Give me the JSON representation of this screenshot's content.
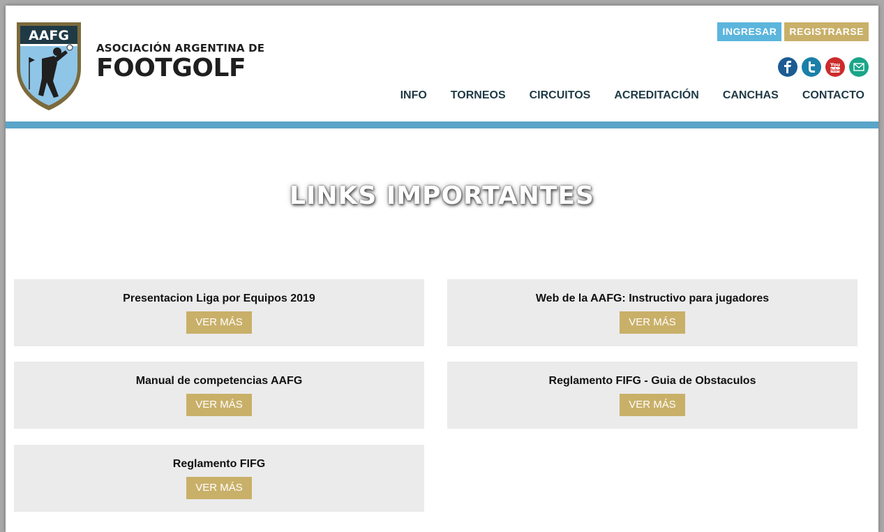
{
  "header": {
    "logo_abbr": "AAFG",
    "brand_line1": "ASOCIACIÓN ARGENTINA DE",
    "brand_line2": "FOOTGOLF",
    "login_label": "INGRESAR",
    "register_label": "REGISTRARSE",
    "social": [
      {
        "name": "facebook-icon",
        "glyph": "f",
        "color": "#1c5b93"
      },
      {
        "name": "twitter-icon",
        "glyph": "t",
        "color": "#1b7fa8"
      },
      {
        "name": "youtube-icon",
        "glyph": "You Tube",
        "color": "#cc2b2b"
      },
      {
        "name": "mail-icon",
        "glyph": "✉",
        "color": "#1aa589"
      }
    ],
    "nav": [
      "INFO",
      "TORNEOS",
      "CIRCUITOS",
      "ACREDITACIÓN",
      "CANCHAS",
      "CONTACTO"
    ]
  },
  "main": {
    "title": "LINKS IMPORTANTES",
    "links": [
      {
        "title": "Presentacion Liga por Equipos 2019",
        "button": "VER MÁS"
      },
      {
        "title": "Web de la AAFG: Instructivo para jugadores",
        "button": "VER MÁS"
      },
      {
        "title": "Manual de competencias AAFG",
        "button": "VER MÁS"
      },
      {
        "title": "Reglamento FIFG - Guia de Obstaculos",
        "button": "VER MÁS"
      },
      {
        "title": "Reglamento FIFG",
        "button": "VER MÁS"
      }
    ]
  },
  "colors": {
    "accent_blue": "#5aa4c9",
    "gold": "#c9b069",
    "card_bg": "#ebebeb"
  }
}
